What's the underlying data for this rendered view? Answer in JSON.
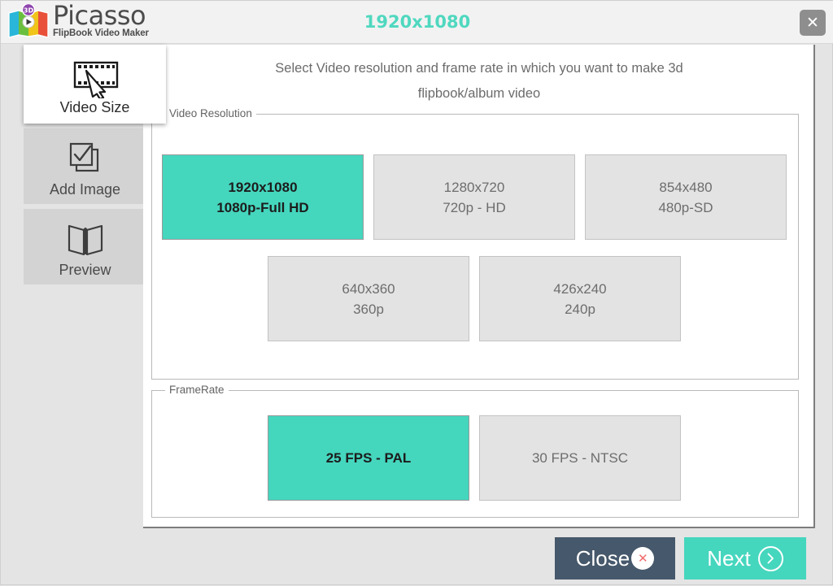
{
  "app": {
    "logo_title": "Picasso",
    "logo_subtitle": "FlipBook Video Maker",
    "logo_badge": "3D",
    "window_title": "1920x1080",
    "close_icon": "close-x-icon"
  },
  "sidebar": {
    "items": [
      {
        "label": "Video Size",
        "icon": "film-strip-cursor-icon",
        "active": true
      },
      {
        "label": "Add Image",
        "icon": "checked-images-icon",
        "active": false
      },
      {
        "label": "Preview",
        "icon": "open-book-icon",
        "active": false
      }
    ]
  },
  "main": {
    "instructions_line1": "Select Video resolution and frame rate in which you want to make 3d",
    "instructions_line2": "flipbook/album video",
    "resolution_group_label": "Video Resolution",
    "framerate_group_label": "FrameRate",
    "resolutions": [
      {
        "line1": "1920x1080",
        "line2": "1080p-Full HD",
        "selected": true
      },
      {
        "line1": "1280x720",
        "line2": "720p - HD",
        "selected": false
      },
      {
        "line1": "854x480",
        "line2": "480p-SD",
        "selected": false
      },
      {
        "line1": "640x360",
        "line2": "360p",
        "selected": false
      },
      {
        "line1": "426x240",
        "line2": "240p",
        "selected": false
      }
    ],
    "framerates": [
      {
        "label": "25 FPS - PAL",
        "selected": true
      },
      {
        "label": "30 FPS - NTSC",
        "selected": false
      }
    ]
  },
  "footer": {
    "close_label": "Close",
    "close_icon": "red-x-circle-icon",
    "next_label": "Next",
    "next_icon": "chevron-right-circle-icon"
  },
  "colors": {
    "accent_teal": "#45d6be",
    "title_teal": "#4fd8bf",
    "close_navy": "#46586b",
    "close_x_red": "#f26a6a",
    "option_gray": "#e3e3e3",
    "page_bg": "#e4e4e4"
  }
}
